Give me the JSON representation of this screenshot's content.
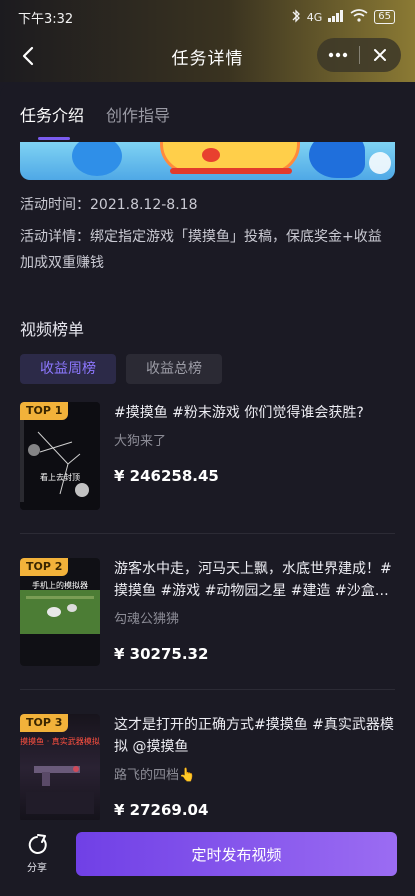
{
  "status_bar": {
    "time": "下午3:32",
    "network": "4G",
    "battery": "65"
  },
  "nav": {
    "title": "任务详情",
    "more_icon": "more-dots-icon",
    "close_icon": "close-icon"
  },
  "tabs": [
    {
      "label": "任务介绍",
      "active": true
    },
    {
      "label": "创作指导",
      "active": false
    }
  ],
  "activity": {
    "time": "活动时间：2021.8.12-8.18",
    "details": "活动详情：绑定指定游戏「摸摸鱼」投稿，保底奖金+收益加成双重赚钱"
  },
  "leaderboard": {
    "title": "视频榜单",
    "chips": [
      {
        "label": "收益周榜",
        "active": true
      },
      {
        "label": "收益总榜",
        "active": false
      }
    ],
    "items": [
      {
        "rank": "TOP 1",
        "title": "#摸摸鱼 #粉末游戏 你们觉得谁会获胜?",
        "author": "大狗来了",
        "amount": "¥ 246258.45",
        "thumb_caption": "看上去封顶"
      },
      {
        "rank": "TOP 2",
        "title": "游客水中走，河马天上飘，水底世界建成！#摸摸鱼 #游戏 #动物园之星 #建造 #沙盒…",
        "author": "勾魂公狒狒",
        "amount": "¥ 30275.32",
        "thumb_caption": "手机上的模拟器"
      },
      {
        "rank": "TOP 3",
        "title": "这才是打开的正确方式#摸摸鱼 #真实武器模拟 @摸摸鱼",
        "author": "路飞的四档👆",
        "amount": "¥ 27269.04",
        "thumb_caption": "摸摸鱼 · 真实武器模拟"
      }
    ]
  },
  "bottom": {
    "share_label": "分享",
    "publish_label": "定时发布视频"
  },
  "colors": {
    "accent": "#7b5cf0",
    "badge": "#f2b23a",
    "background": "#1b1a24"
  }
}
